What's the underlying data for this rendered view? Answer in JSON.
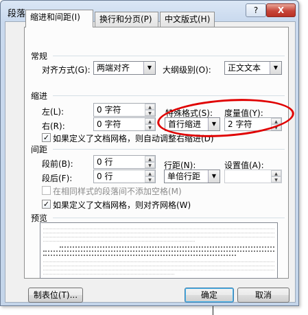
{
  "dialog": {
    "title": "段落",
    "help_button": "?",
    "close_button": "X"
  },
  "tabs": [
    {
      "label": "缩进和间距(I)",
      "active": true
    },
    {
      "label": "换行和分页(P)",
      "active": false
    },
    {
      "label": "中文版式(H)",
      "active": false
    }
  ],
  "general": {
    "section": "常规",
    "alignment_label": "对齐方式(G):",
    "alignment_value": "两端对齐",
    "outline_label": "大纲级别(O):",
    "outline_value": "正文文本"
  },
  "indent": {
    "section": "缩进",
    "left_label": "左(L):",
    "left_value": "0 字符",
    "right_label": "右(R):",
    "right_value": "0 字符",
    "special_label": "特殊格式(S):",
    "special_value": "首行缩进",
    "measure_label": "度量值(Y):",
    "measure_value": "2 字符",
    "auto_adjust_label": "如果定义了文档网格，则自动调整右缩进(D)",
    "auto_adjust_checked": true
  },
  "spacing": {
    "section": "间距",
    "before_label": "段前(B):",
    "before_value": "0 行",
    "after_label": "段后(F):",
    "after_value": "0 行",
    "line_label": "行距(N):",
    "line_value": "单倍行距",
    "setting_label": "设置值(A):",
    "setting_value": "",
    "no_space_label": "在相同样式的段落间不添加空格(M)",
    "no_space_checked": false,
    "snap_grid_label": "如果定义了文档网格，则对齐网格(W)",
    "snap_grid_checked": true
  },
  "preview": {
    "section": "预览"
  },
  "buttons": {
    "tabs_label": "制表位(T)...",
    "ok_label": "确定",
    "cancel_label": "取消"
  },
  "colors": {
    "annotation_ellipse": "#e00000",
    "ok_button_focus": "#48b3e8"
  }
}
